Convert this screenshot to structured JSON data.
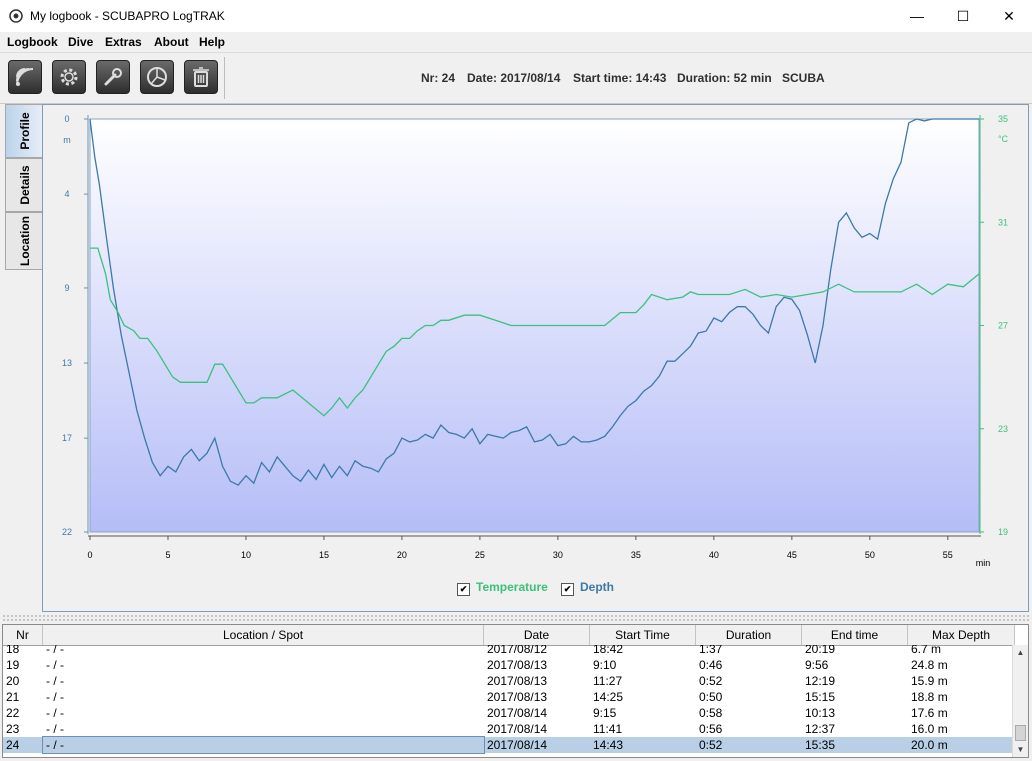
{
  "window": {
    "title": "My logbook - SCUBAPRO LogTRAK",
    "minimize": "—",
    "maximize": "☐",
    "close": "✕"
  },
  "menu": [
    "Logbook",
    "Dive",
    "Extras",
    "About",
    "Help"
  ],
  "toolbar": {
    "buttons": [
      "signal-icon",
      "gear-icon",
      "wrench-icon",
      "pie-chart-icon",
      "trash-icon"
    ],
    "dive": {
      "nr": "Nr: 24",
      "date": "Date: 2017/08/14",
      "start": "Start time: 14:43",
      "duration": "Duration: 52 min",
      "mode": "SCUBA"
    }
  },
  "side_tabs": [
    "Profile",
    "Details",
    "Location"
  ],
  "chart_data": {
    "type": "line",
    "x_unit": "min",
    "y_left_unit": "m",
    "y_right_unit": "°C",
    "x_ticks": [
      0,
      5,
      10,
      15,
      20,
      25,
      30,
      35,
      40,
      45,
      50,
      55
    ],
    "y_left_ticks": [
      0,
      4,
      9,
      13,
      17,
      22
    ],
    "y_right_ticks": [
      35,
      31,
      27,
      23,
      19
    ],
    "xlim": [
      0,
      57
    ],
    "ylim_left": [
      22,
      0
    ],
    "ylim_right": [
      19,
      35
    ],
    "series": [
      {
        "name": "Depth",
        "axis": "left",
        "color": "#3c79a8",
        "x": [
          0,
          0.3,
          0.6,
          1,
          1.5,
          2,
          2.5,
          3,
          3.5,
          4,
          4.5,
          5,
          5.5,
          6,
          6.5,
          7,
          7.5,
          8,
          8.5,
          9,
          9.5,
          10,
          10.5,
          11,
          11.5,
          12,
          12.5,
          13,
          13.5,
          14,
          14.5,
          15,
          15.5,
          16,
          16.5,
          17,
          17.5,
          18,
          18.5,
          19,
          19.5,
          20,
          20.5,
          21,
          21.5,
          22,
          22.5,
          23,
          23.5,
          24,
          24.5,
          25,
          25.5,
          26,
          26.5,
          27,
          27.5,
          28,
          28.5,
          29,
          29.5,
          30,
          30.5,
          31,
          31.5,
          32,
          32.5,
          33,
          33.5,
          34,
          34.5,
          35,
          35.5,
          36,
          36.5,
          37,
          37.5,
          38,
          38.5,
          39,
          39.5,
          40,
          40.5,
          41,
          41.5,
          42,
          42.5,
          43,
          43.5,
          44,
          44.5,
          45,
          45.5,
          46,
          46.5,
          47,
          47.5,
          48,
          48.5,
          49,
          49.5,
          50,
          50.5,
          51,
          51.5,
          52,
          52.5,
          53,
          53.5,
          54,
          55,
          56,
          57
        ],
        "y": [
          0,
          2,
          3.5,
          6,
          9,
          11.5,
          13.5,
          15.5,
          17,
          18.3,
          19,
          18.5,
          18.8,
          18,
          17.6,
          18.2,
          17.8,
          17,
          18.5,
          19.3,
          19.5,
          19,
          19.4,
          18.3,
          18.8,
          18,
          18.5,
          19,
          19.3,
          18.7,
          19.2,
          18.4,
          19.1,
          18.5,
          19,
          18.2,
          18.5,
          18.6,
          18.8,
          18.1,
          17.8,
          17,
          17.2,
          17.1,
          16.8,
          17,
          16.3,
          16.7,
          16.8,
          17,
          16.5,
          17.3,
          16.8,
          16.9,
          17,
          16.7,
          16.6,
          16.4,
          17.2,
          17.1,
          16.8,
          17.4,
          17.3,
          16.9,
          17.2,
          17.2,
          17.1,
          16.9,
          16.4,
          15.8,
          15.3,
          15,
          14.5,
          14.2,
          13.7,
          12.9,
          12.9,
          12.5,
          12.1,
          11.4,
          11.3,
          10.6,
          10.8,
          10.3,
          10,
          10,
          10.4,
          11,
          11.4,
          10,
          9.5,
          9.6,
          10.2,
          11.5,
          13,
          11,
          8,
          5.5,
          5,
          5.8,
          6.3,
          6.1,
          6.4,
          4.5,
          3.2,
          2.3,
          0.2,
          0,
          0.1,
          0,
          0,
          0,
          0
        ]
      },
      {
        "name": "Temperature",
        "axis": "right",
        "color": "#3cc17c",
        "x": [
          0,
          0.5,
          1,
          1.3,
          1.8,
          2.2,
          2.8,
          3.2,
          3.7,
          4.3,
          4.8,
          5.3,
          5.8,
          6.5,
          7.5,
          8,
          8.5,
          9,
          9.5,
          10,
          10.5,
          11,
          12,
          13,
          14,
          15,
          15.5,
          16,
          16.5,
          17,
          17.5,
          18,
          18.5,
          19,
          19.5,
          20,
          20.5,
          21,
          21.5,
          22,
          22.5,
          23,
          24,
          25,
          26,
          27,
          28,
          29,
          30,
          31,
          32,
          33,
          34,
          35,
          35.5,
          36,
          37,
          38,
          38.5,
          39,
          40,
          41,
          42,
          43,
          44,
          45,
          46,
          47,
          48,
          49,
          50,
          51,
          52,
          53,
          54,
          55,
          56,
          57
        ],
        "y": [
          30,
          30,
          29,
          28,
          27.5,
          27,
          26.8,
          26.5,
          26.5,
          26,
          25.5,
          25,
          24.8,
          24.8,
          24.8,
          25.5,
          25.5,
          25,
          24.5,
          24,
          24,
          24.2,
          24.2,
          24.5,
          24,
          23.5,
          23.8,
          24.2,
          23.8,
          24.2,
          24.5,
          25,
          25.5,
          26,
          26.2,
          26.5,
          26.5,
          26.8,
          27,
          27,
          27.2,
          27.2,
          27.4,
          27.4,
          27.2,
          27,
          27,
          27,
          27,
          27,
          27,
          27,
          27.5,
          27.5,
          27.8,
          28.2,
          28,
          28.1,
          28.3,
          28.2,
          28.2,
          28.2,
          28.4,
          28.1,
          28.2,
          28.1,
          28.2,
          28.3,
          28.6,
          28.3,
          28.3,
          28.3,
          28.3,
          28.6,
          28.2,
          28.6,
          28.5,
          29
        ]
      }
    ]
  },
  "legend": {
    "temperature": "Temperature",
    "depth": "Depth",
    "check": "✔"
  },
  "table": {
    "columns": [
      "Nr",
      "Location / Spot",
      "Date",
      "Start Time",
      "Duration",
      "End time",
      "Max Depth"
    ],
    "rows": [
      [
        "18",
        "- / -",
        "2017/08/12",
        "18:42",
        "1:37",
        "20:19",
        "6.7 m"
      ],
      [
        "19",
        "- / -",
        "2017/08/13",
        "9:10",
        "0:46",
        "9:56",
        "24.8 m"
      ],
      [
        "20",
        "- / -",
        "2017/08/13",
        "11:27",
        "0:52",
        "12:19",
        "15.9 m"
      ],
      [
        "21",
        "- / -",
        "2017/08/13",
        "14:25",
        "0:50",
        "15:15",
        "18.8 m"
      ],
      [
        "22",
        "- / -",
        "2017/08/14",
        "9:15",
        "0:58",
        "10:13",
        "17.6 m"
      ],
      [
        "23",
        "- / -",
        "2017/08/14",
        "11:41",
        "0:56",
        "12:37",
        "16.0 m"
      ],
      [
        "24",
        "- / -",
        "2017/08/14",
        "14:43",
        "0:52",
        "15:35",
        "20.0 m"
      ]
    ],
    "selected_index": 6
  }
}
